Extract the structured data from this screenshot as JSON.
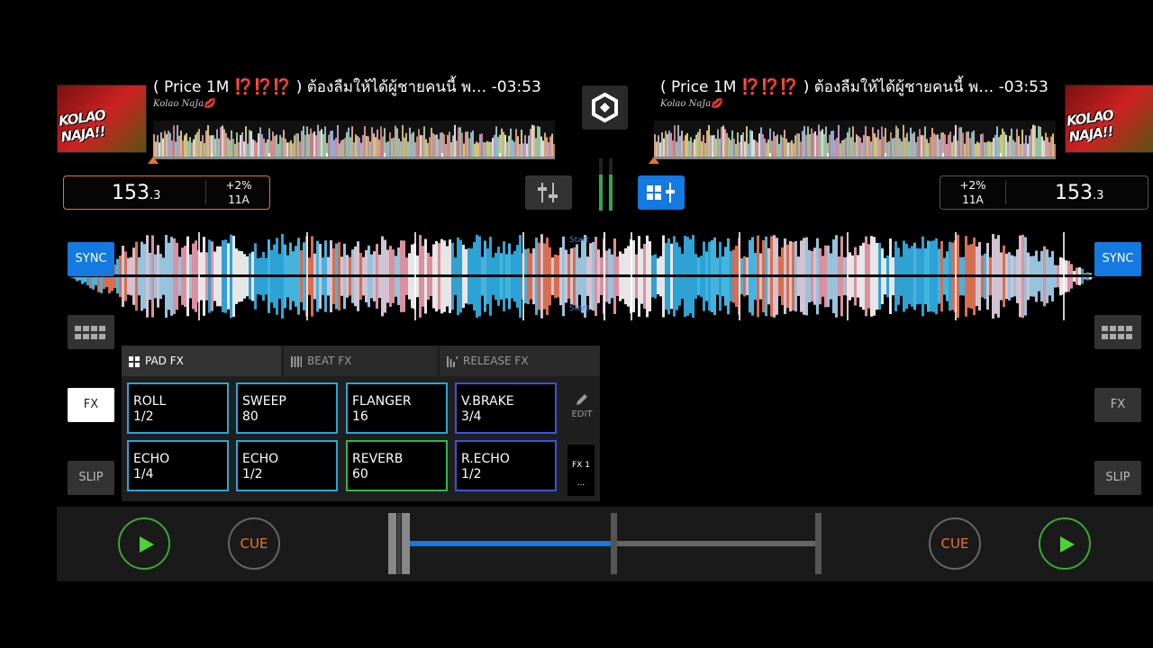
{
  "deck_a": {
    "cover_label": "KOLAO NAJA!!",
    "title": "( Price 1M ⁉️⁉️⁉️ ) ต้องลืมให้ได้ผู้ชายคนนี้  พ…",
    "time": "-03:53",
    "artist": "Kolao NaJa💋",
    "bpm": "153",
    "bpm_decimal": ".3",
    "pitch": "+2%",
    "key": "11A",
    "sync_label": "SYNC",
    "fx_label": "FX",
    "slip_label": "SLIP",
    "cue_label": "CUE"
  },
  "deck_b": {
    "cover_label": "KOLAO NAJA!!",
    "title": "( Price 1M ⁉️⁉️⁉️ ) ต้องลืมให้ได้ผู้ชายคนนี้  พ…",
    "time": "-03:53",
    "artist": "Kolao NaJa💋",
    "bpm": "153",
    "bpm_decimal": ".3",
    "pitch": "+2%",
    "key": "11A",
    "sync_label": "SYNC",
    "fx_label": "FX",
    "slip_label": "SLIP",
    "cue_label": "CUE"
  },
  "fx_panel": {
    "tabs": [
      "PAD FX",
      "BEAT FX",
      "RELEASE FX"
    ],
    "active_tab": "PAD FX",
    "pads": [
      {
        "name": "ROLL",
        "value": "1/2",
        "color": "#2aa6d8"
      },
      {
        "name": "SWEEP",
        "value": "80",
        "color": "#2aa6d8"
      },
      {
        "name": "FLANGER",
        "value": "16",
        "color": "#2aa6d8"
      },
      {
        "name": "V.BRAKE",
        "value": "3/4",
        "color": "#3a55d8"
      },
      {
        "name": "ECHO",
        "value": "1/4",
        "color": "#2aa6d8"
      },
      {
        "name": "ECHO",
        "value": "1/2",
        "color": "#2aa6d8"
      },
      {
        "name": "REVERB",
        "value": "60",
        "color": "#2fb84a"
      },
      {
        "name": "R.ECHO",
        "value": "1/2",
        "color": "#3a55d8"
      }
    ],
    "edit_label": "EDIT",
    "bank_label": "FX 1",
    "bank_more": "..."
  },
  "waveform": {
    "markers": [
      "Start",
      "Start"
    ]
  },
  "crossfader": {
    "position": 0.5
  },
  "colors": {
    "accent_blue": "#1479e0",
    "accent_orange": "#e8742b",
    "play_green": "#4cd136"
  }
}
